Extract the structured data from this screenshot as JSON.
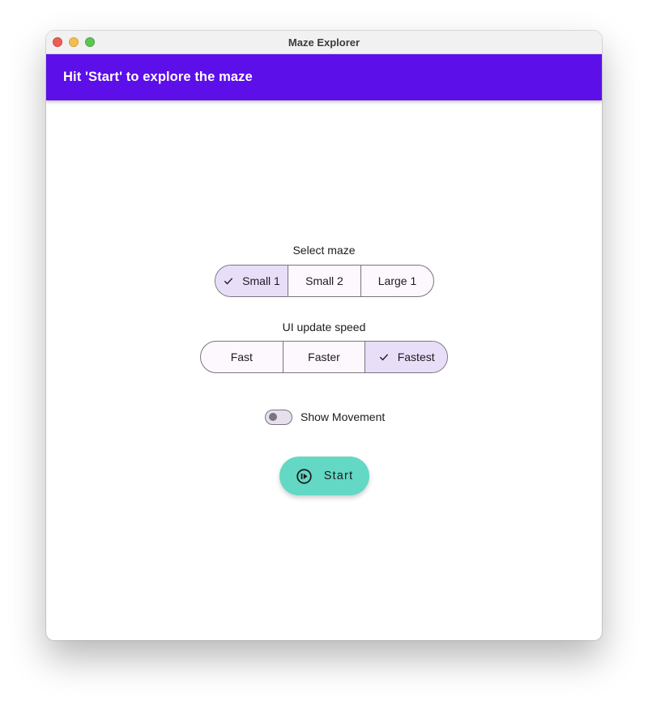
{
  "window": {
    "title": "Maze Explorer"
  },
  "appbar": {
    "title": "Hit 'Start' to explore the maze",
    "color": "#5c0fe8"
  },
  "maze_select": {
    "label": "Select maze",
    "options": [
      "Small 1",
      "Small 2",
      "Large 1"
    ],
    "selected": "Small 1"
  },
  "speed_select": {
    "label": "UI update speed",
    "options": [
      "Fast",
      "Faster",
      "Fastest"
    ],
    "selected": "Fastest"
  },
  "movement_toggle": {
    "label": "Show Movement",
    "on": false
  },
  "start_button": {
    "label": "Start",
    "icon": "play-circle-icon",
    "color": "#63d8c4"
  }
}
